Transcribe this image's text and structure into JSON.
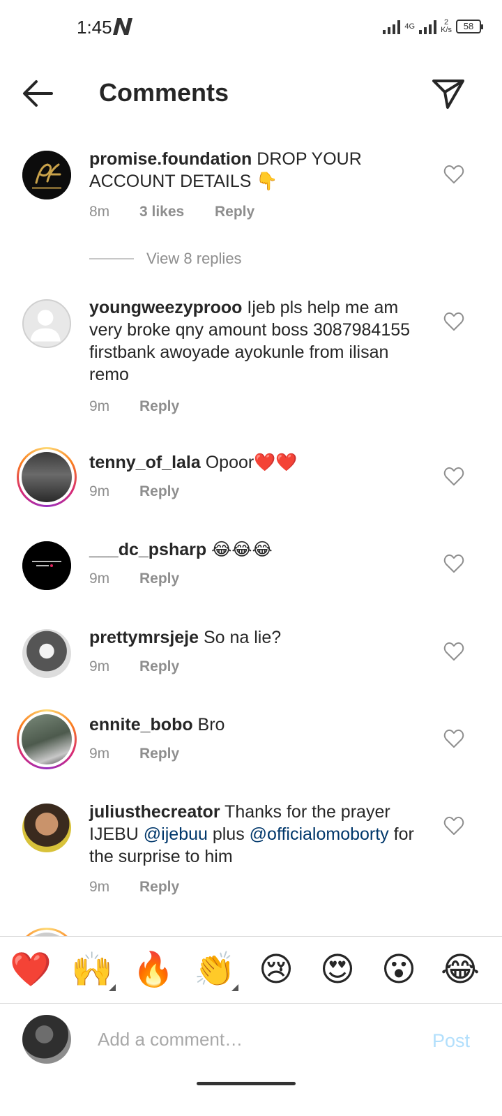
{
  "status_bar": {
    "time": "1:45",
    "network": "4G",
    "speed_value": "2",
    "speed_unit": "K/s",
    "battery": "58"
  },
  "header": {
    "title": "Comments"
  },
  "comments": [
    {
      "username": "promise.foundation",
      "text": " DROP YOUR ACCOUNT DETAILS 👇",
      "time": "8m",
      "likes": "3 likes",
      "reply": "Reply",
      "view_replies": "View 8 replies"
    },
    {
      "username": "youngweezyprooo",
      "text": " Ijeb pls help me am very broke qny amount boss 3087984155 firstbank awoyade ayokunle from ilisan remo",
      "time": "9m",
      "reply": "Reply"
    },
    {
      "username": "tenny_of_lala",
      "text": " Opoor❤️❤️",
      "time": "9m",
      "reply": "Reply"
    },
    {
      "username": "___dc_psharp",
      "text": " 😂😂😂",
      "time": "9m",
      "reply": "Reply"
    },
    {
      "username": "prettymrsjeje",
      "text": " So na lie?",
      "time": "9m",
      "reply": "Reply"
    },
    {
      "username": "ennite_bobo",
      "text": " Bro",
      "time": "9m",
      "reply": "Reply"
    },
    {
      "username": "juliusthecreator",
      "text_before": " Thanks for the prayer IJEBU ",
      "mention1": "@ijebuu",
      "text_middle": " plus ",
      "mention2": "@officialomoborty",
      "text_after": " for the surprise to him",
      "time": "9m",
      "reply": "Reply"
    }
  ],
  "emoji_bar": [
    "❤️",
    "🙌",
    "🔥",
    "👏",
    "😢",
    "😍",
    "😮",
    "😂"
  ],
  "input": {
    "placeholder": "Add a comment…",
    "post_label": "Post"
  },
  "colors": {
    "mention": "#00376b",
    "muted": "#8e8e8e",
    "post_disabled": "#b2dffc"
  }
}
